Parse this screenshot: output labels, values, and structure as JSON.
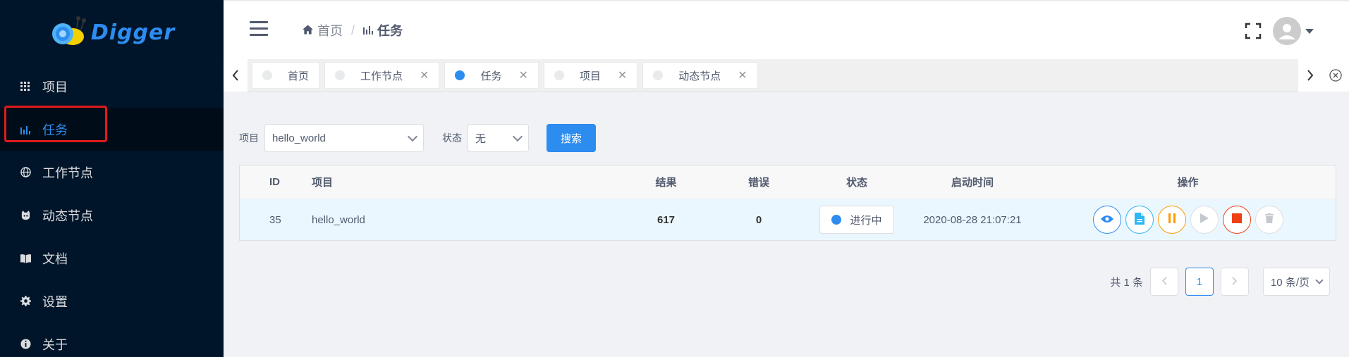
{
  "app": {
    "logo_text": "Digger"
  },
  "sidebar": {
    "items": [
      {
        "label": "项目",
        "icon": "grid-icon"
      },
      {
        "label": "任务",
        "icon": "bar-chart-icon",
        "active": true
      },
      {
        "label": "工作节点",
        "icon": "globe-icon"
      },
      {
        "label": "动态节点",
        "icon": "github-icon"
      },
      {
        "label": "文档",
        "icon": "book-icon"
      },
      {
        "label": "设置",
        "icon": "gear-icon"
      },
      {
        "label": "关于",
        "icon": "info-icon"
      }
    ]
  },
  "header": {
    "breadcrumb": [
      {
        "label": "首页",
        "icon": "home-icon"
      },
      {
        "label": "任务",
        "icon": "bar-chart-icon"
      }
    ]
  },
  "tabs": [
    {
      "label": "首页",
      "closable": false,
      "active": false
    },
    {
      "label": "工作节点",
      "closable": true,
      "active": false
    },
    {
      "label": "任务",
      "closable": true,
      "active": true
    },
    {
      "label": "项目",
      "closable": true,
      "active": false
    },
    {
      "label": "动态节点",
      "closable": true,
      "active": false
    }
  ],
  "filters": {
    "project_label": "项目",
    "project_value": "hello_world",
    "status_label": "状态",
    "status_value": "无",
    "search_button": "搜索"
  },
  "table": {
    "columns": [
      "ID",
      "项目",
      "结果",
      "错误",
      "状态",
      "启动时间",
      "操作"
    ],
    "rows": [
      {
        "id": "35",
        "project": "hello_world",
        "result": "617",
        "errors": "0",
        "status": "进行中",
        "start_time": "2020-08-28 21:07:21"
      }
    ]
  },
  "pagination": {
    "total_text": "共 1 条",
    "current_page": "1",
    "page_size": "10 条/页"
  },
  "colors": {
    "sidebar_bg": "#001529",
    "primary": "#2d8cf0",
    "warning": "#ff9900",
    "danger": "#ed4014",
    "highlight": "#e01b1b"
  }
}
